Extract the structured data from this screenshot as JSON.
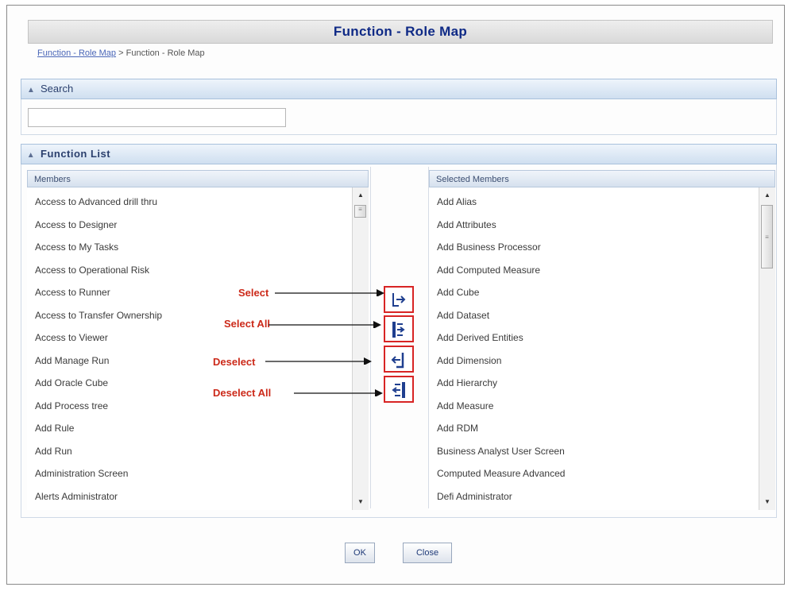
{
  "title": "Function - Role Map",
  "breadcrumb": {
    "link": "Function - Role Map",
    "separator": ">",
    "current": "Function - Role Map"
  },
  "search": {
    "section_label": "Search",
    "value": "",
    "placeholder": ""
  },
  "function_list": {
    "section_label": "Function List",
    "members_header": "Members",
    "selected_header": "Selected Members",
    "members": [
      "Access to Advanced drill thru",
      "Access to Designer",
      "Access to My Tasks",
      "Access to Operational Risk",
      "Access to Runner",
      "Access to Transfer Ownership",
      "Access to Viewer",
      "Add Manage Run",
      "Add Oracle Cube",
      "Add Process tree",
      "Add Rule",
      "Add Run",
      "Administration Screen",
      "Alerts Administrator"
    ],
    "selected": [
      "Add Alias",
      "Add Attributes",
      "Add Business Processor",
      "Add Computed Measure",
      "Add Cube",
      "Add Dataset",
      "Add Derived Entities",
      "Add Dimension",
      "Add Hierarchy",
      "Add Measure",
      "Add RDM",
      "Business Analyst User Screen",
      "Computed Measure Advanced",
      "Defi Administrator"
    ]
  },
  "annotations": {
    "select": "Select",
    "select_all": "Select All",
    "deselect": "Deselect",
    "deselect_all": "Deselect All"
  },
  "buttons": {
    "ok": "OK",
    "close": "Close"
  },
  "colors": {
    "title": "#0f2a86",
    "annotation": "#cc2a1a",
    "button_outline": "#d82424"
  }
}
